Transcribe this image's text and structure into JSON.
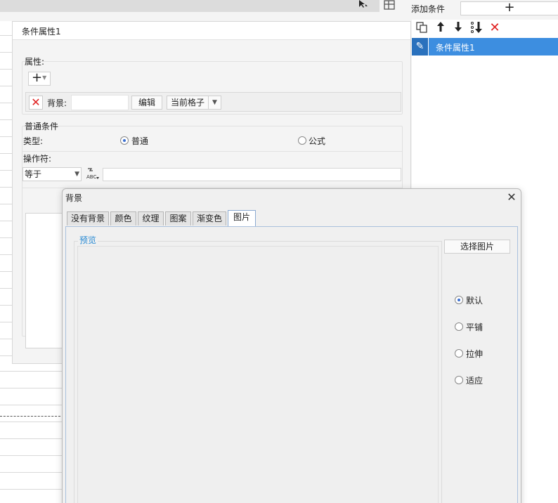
{
  "top": {
    "cursor_icon": "cursor-arrow-icon",
    "layout_icon": "layout-grid-icon"
  },
  "condition_panel": {
    "title": "条件属性1",
    "attributes": {
      "label": "属性:",
      "add_button": "+",
      "background_label": "背景:",
      "edit_button": "编辑",
      "scope_select": "当前格子"
    },
    "normal_condition": {
      "label": "普通条件",
      "type_label": "类型:",
      "type_options": [
        "普通",
        "公式"
      ],
      "selected_type": "普通",
      "operator_label": "操作符:",
      "operator_value": "等于",
      "operand_value": ""
    }
  },
  "side_panel": {
    "add_condition_label": "添加条件",
    "add_condition_button": "+",
    "tools": [
      "copy-icon",
      "move-up-icon",
      "move-down-icon",
      "sort-down-icon",
      "delete-icon"
    ],
    "items": [
      {
        "label": "条件属性1",
        "selected": true
      }
    ]
  },
  "background_dialog": {
    "title": "背景",
    "tabs": [
      "没有背景",
      "颜色",
      "纹理",
      "图案",
      "渐变色",
      "图片"
    ],
    "active_tab": "图片",
    "preview_label": "预览",
    "choose_image_button": "选择图片",
    "layout_options": [
      "默认",
      "平铺",
      "拉伸",
      "适应"
    ],
    "selected_layout": "默认"
  },
  "colors": {
    "accent": "#3d8ee0",
    "delete": "#e02020",
    "preview_label": "#2b8bd3"
  }
}
